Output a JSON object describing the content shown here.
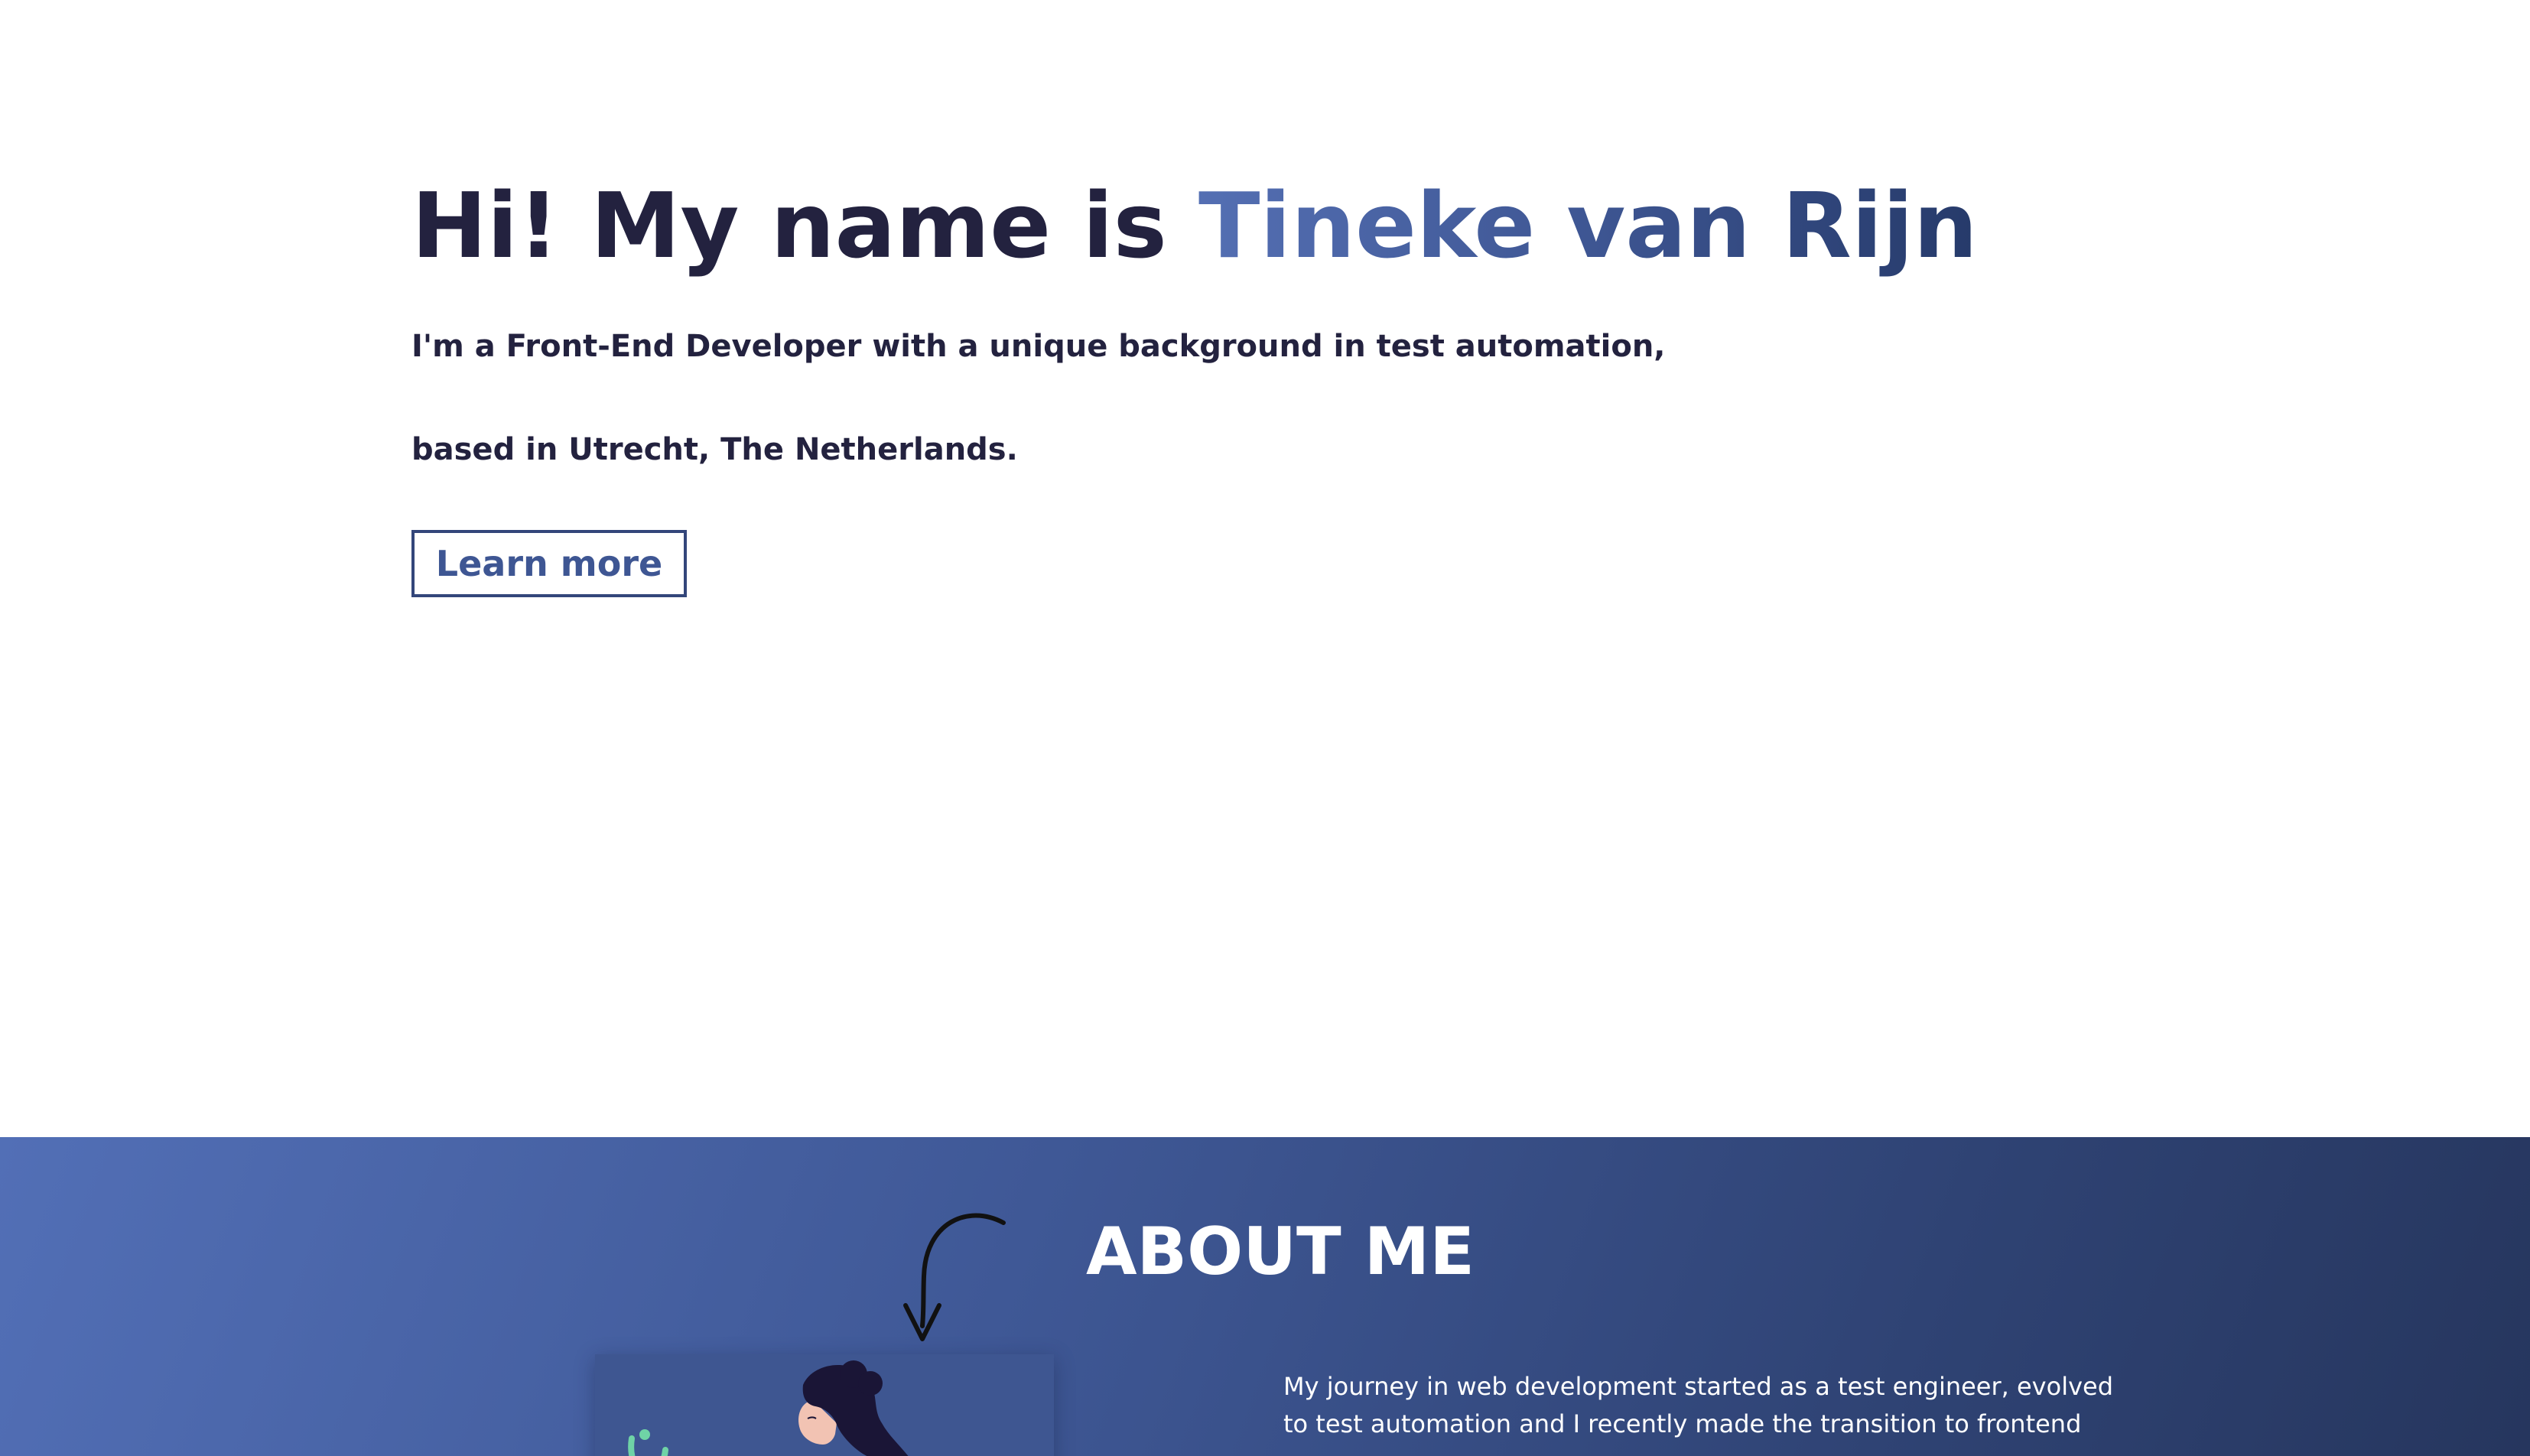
{
  "hero": {
    "title_prefix": "Hi! My name is ",
    "title_name": "Tineke van Rijn",
    "line1": "I'm a Front-End Developer with a unique background in test automation,",
    "line2": "based in Utrecht, The Netherlands.",
    "learn_more_label": "Learn more"
  },
  "about": {
    "title": "ABOUT ME",
    "text": "My journey in web development started as a test engineer, evolved to test automation and I recently made the transition to frontend"
  },
  "icons": {
    "arrow": "curved-arrow-down-icon",
    "illustration": "woman-illustration"
  },
  "colors": {
    "heading": "#23223f",
    "accent_start": "#546fb3",
    "accent_end": "#263a6a",
    "about_bg_start": "#526fb6",
    "about_bg_end": "#26365e",
    "plant": "#6fd3a6"
  }
}
